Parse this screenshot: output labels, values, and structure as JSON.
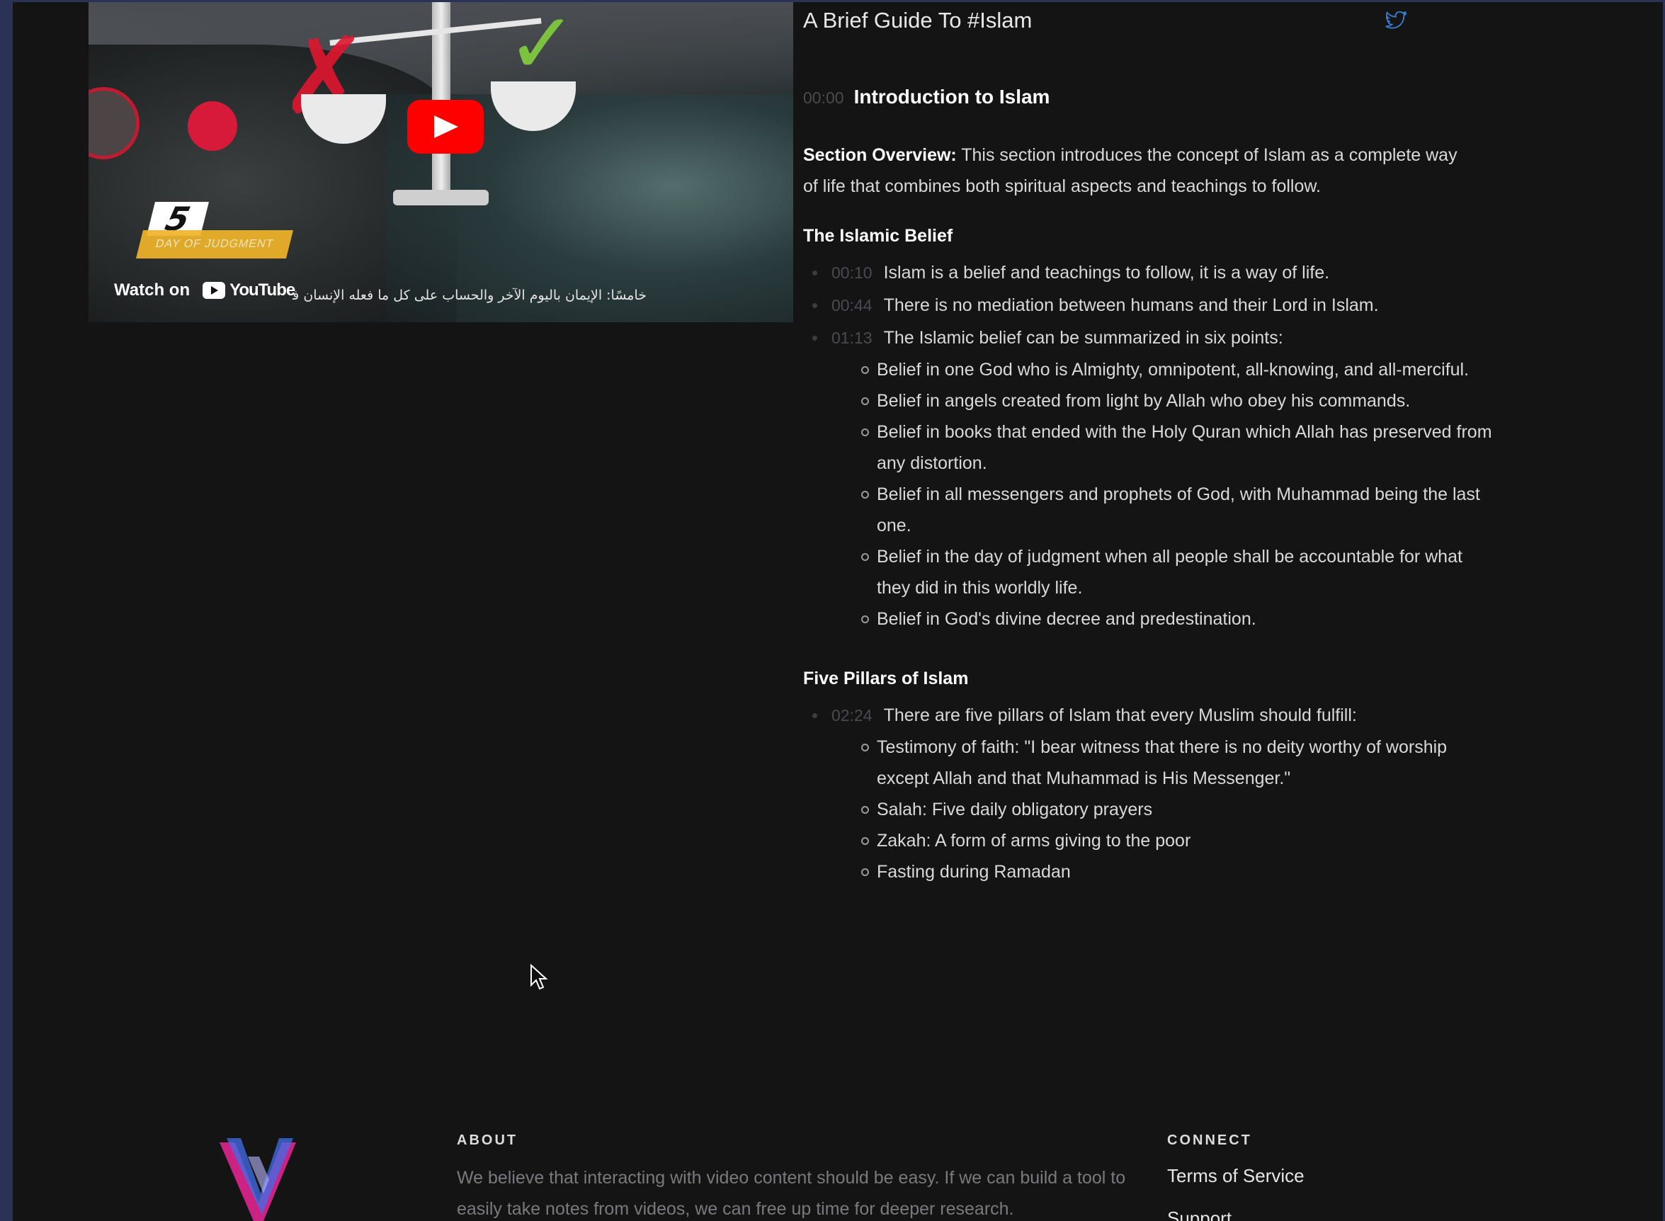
{
  "video": {
    "episode_number": "5",
    "episode_label": "DAY OF JUDGMENT",
    "watch_on_label": "Watch on",
    "youtube_label": "YouTube",
    "subtitle_arabic": "خامسًا: الإيمان باليوم الآخر والحساب على كل ما فعله الإنسان في",
    "play_icon": "play-icon",
    "brand_color": "#ff0000"
  },
  "header": {
    "title": "A Brief Guide To #Islam",
    "share_icon": "twitter-icon"
  },
  "intro": {
    "timestamp": "00:00",
    "title": "Introduction to Islam"
  },
  "overview": {
    "label": "Section Overview:",
    "text": " This section introduces the concept of Islam as a complete way of life that combines both spiritual aspects and teachings to follow."
  },
  "belief": {
    "heading": "The Islamic Belief",
    "items": [
      {
        "timestamp": "00:10",
        "text": "Islam is a belief and teachings to follow, it is a way of life."
      },
      {
        "timestamp": "00:44",
        "text": "There is no mediation between humans and their Lord in Islam."
      },
      {
        "timestamp": "01:13",
        "text": "The Islamic belief can be summarized in six points:"
      }
    ],
    "points": [
      "Belief in one God who is Almighty, omnipotent, all-knowing, and all-merciful.",
      "Belief in angels created from light by Allah who obey his commands.",
      "Belief in books that ended with the Holy Quran which Allah has preserved from any distortion.",
      "Belief in all messengers and prophets of God, with Muhammad being the last one.",
      "Belief in the day of judgment when all people shall be accountable for what they did in this worldly life.",
      "Belief in God's divine decree and predestination."
    ]
  },
  "pillars": {
    "heading": "Five Pillars of Islam",
    "items": [
      {
        "timestamp": "02:24",
        "text": "There are five pillars of Islam that every Muslim should fulfill:"
      }
    ],
    "points": [
      "Testimony of faith: \"I bear witness that there is no deity worthy of worship except Allah and that Muhammad is His Messenger.\"",
      "Salah: Five daily obligatory prayers",
      "Zakah: A form of arms giving to the poor",
      "Fasting during Ramadan"
    ]
  },
  "footer": {
    "about_heading": "ABOUT",
    "about_text": "We believe that interacting with video content should be easy. If we can build a tool to easily take notes from videos, we can free up time for deeper research.",
    "connect_heading": "CONNECT",
    "links": [
      "Terms of Service",
      "Support"
    ],
    "logo_icon": "v-logo-icon"
  }
}
